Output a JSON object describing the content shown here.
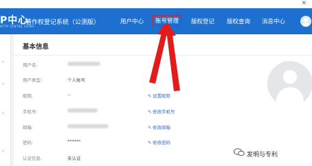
{
  "header": {
    "logo_text": "P中心",
    "logo_sub": "HTTP CENTRE CHINA",
    "system_title": "著作权登记系统（公测版）",
    "nav": [
      {
        "label": "用户中心"
      },
      {
        "label": "账号管理",
        "active": true
      },
      {
        "label": "版权登记"
      },
      {
        "label": "版权查询"
      },
      {
        "label": "消息中心"
      }
    ],
    "close_glyph": "✕"
  },
  "section": {
    "title": "基本信息"
  },
  "fields": [
    {
      "label": "用户名:",
      "value": "",
      "blurred": true,
      "action": ""
    },
    {
      "label": "用户类型:",
      "value": "个人账号",
      "blurred": false,
      "action": ""
    },
    {
      "label": "昵称:",
      "value": "--",
      "blurred": false,
      "action": "设置昵称"
    },
    {
      "label": "手机号:",
      "value": "",
      "blurred": true,
      "action": "修改手机号"
    },
    {
      "label": "邮箱:",
      "value": "",
      "blurred": true,
      "action": "修改邮箱"
    },
    {
      "label": "密码:",
      "value": "******",
      "blurred": false,
      "action": "修改密码"
    },
    {
      "label": "认证信息:",
      "value": "未认证",
      "blurred": false,
      "action": ""
    }
  ],
  "watermark": {
    "text": "发明与专利"
  },
  "colors": {
    "header_bg": "#1d6fd0",
    "highlight": "#e21b1b",
    "link": "#2b6fd6"
  },
  "icons": {
    "action": "pencil-icon",
    "avatar": "user-avatar-icon",
    "sidebar": "chevron-right-icon",
    "watermark": "wechat-icon"
  }
}
